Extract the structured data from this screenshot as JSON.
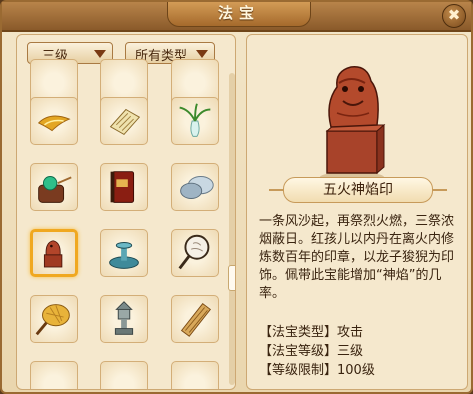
{
  "window": {
    "title": "法宝",
    "close_label": "✖"
  },
  "filters": {
    "grade": "三级",
    "type": "所有类型"
  },
  "items": [
    {
      "name": "golden-tassel",
      "icon": "tassel-icon"
    },
    {
      "name": "scroll",
      "icon": "scroll-icon"
    },
    {
      "name": "vase-willow",
      "icon": "vase-icon"
    },
    {
      "name": "gem-bag",
      "icon": "gem-bag-icon"
    },
    {
      "name": "red-tome",
      "icon": "tome-icon"
    },
    {
      "name": "cymbals",
      "icon": "cymbal-icon"
    },
    {
      "name": "lion-seal",
      "icon": "seal-icon",
      "selected": true
    },
    {
      "name": "fountain",
      "icon": "fountain-icon"
    },
    {
      "name": "mirror",
      "icon": "mirror-icon"
    },
    {
      "name": "palm-fan",
      "icon": "fan-icon"
    },
    {
      "name": "stone-lantern",
      "icon": "lantern-icon"
    },
    {
      "name": "bamboo-slip",
      "icon": "slip-icon"
    }
  ],
  "detail": {
    "name": "五火神焰印",
    "description": "一条风沙起，再祭烈火燃，三祭浓烟蔽日。红孩儿以内丹在离火内修炼数百年的印章，以龙子狻猊为印饰。佩带此宝能增加“神焰”的几率。",
    "type_line": "【法宝类型】攻击",
    "grade_line": "【法宝等级】三级",
    "level_line": "【等级限制】100级"
  },
  "colors": {
    "frame": "#9a6a32",
    "panel": "#f5e8cd",
    "accent": "#f0a820"
  }
}
